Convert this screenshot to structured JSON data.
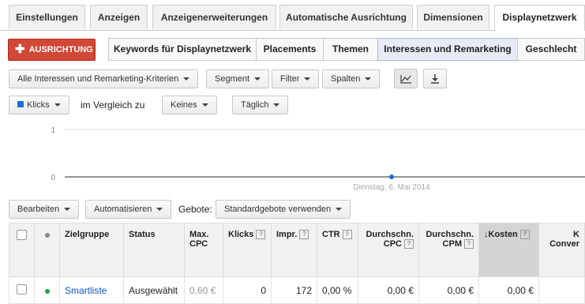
{
  "tabs": [
    "Einstellungen",
    "Anzeigen",
    "Anzeigenerweiterungen",
    "Automatische Ausrichtung",
    "Dimensionen",
    "Displaynetzwerk"
  ],
  "add_button": "AUSRICHTUNG",
  "subtabs": [
    "Keywords für Displaynetzwerk",
    "Placements",
    "Themen",
    "Interessen und Remarketing",
    "Geschlecht"
  ],
  "toolbar": {
    "criteria_filter": "Alle Interessen und Remarketing-Kriterien",
    "segment": "Segment",
    "filter": "Filter",
    "columns": "Spalten"
  },
  "chart_controls": {
    "metric": "Klicks",
    "compare_label": "im Vergleich zu",
    "compare_value": "Keines",
    "period": "Täglich"
  },
  "chart_data": {
    "type": "line",
    "ylim": [
      0,
      1
    ],
    "yticks": [
      "1",
      "0"
    ],
    "x": [
      "Dienstag, 6. Mai 2014"
    ],
    "series": [
      {
        "values": [
          0
        ]
      }
    ],
    "color": "#1a6fd1"
  },
  "table_toolbar": {
    "edit": "Bearbeiten",
    "automate": "Automatisieren",
    "bids_label": "Gebote:",
    "bids_value": "Standardgebote verwenden"
  },
  "table": {
    "headers": [
      "Zielgruppe",
      "Status",
      "Max. CPC",
      "Klicks",
      "Impr.",
      "CTR",
      "Durchschn. CPC",
      "Durchschn. CPM",
      "Kosten",
      "K Conver"
    ],
    "row": {
      "name": "Smartliste",
      "status": "Ausgewählt",
      "max_cpc": "0,60 €",
      "clicks": "0",
      "impr": "172",
      "ctr": "0,00 %",
      "avg_cpc": "0,00 €",
      "avg_cpm": "0,00 €",
      "cost": "0,00 €"
    }
  }
}
